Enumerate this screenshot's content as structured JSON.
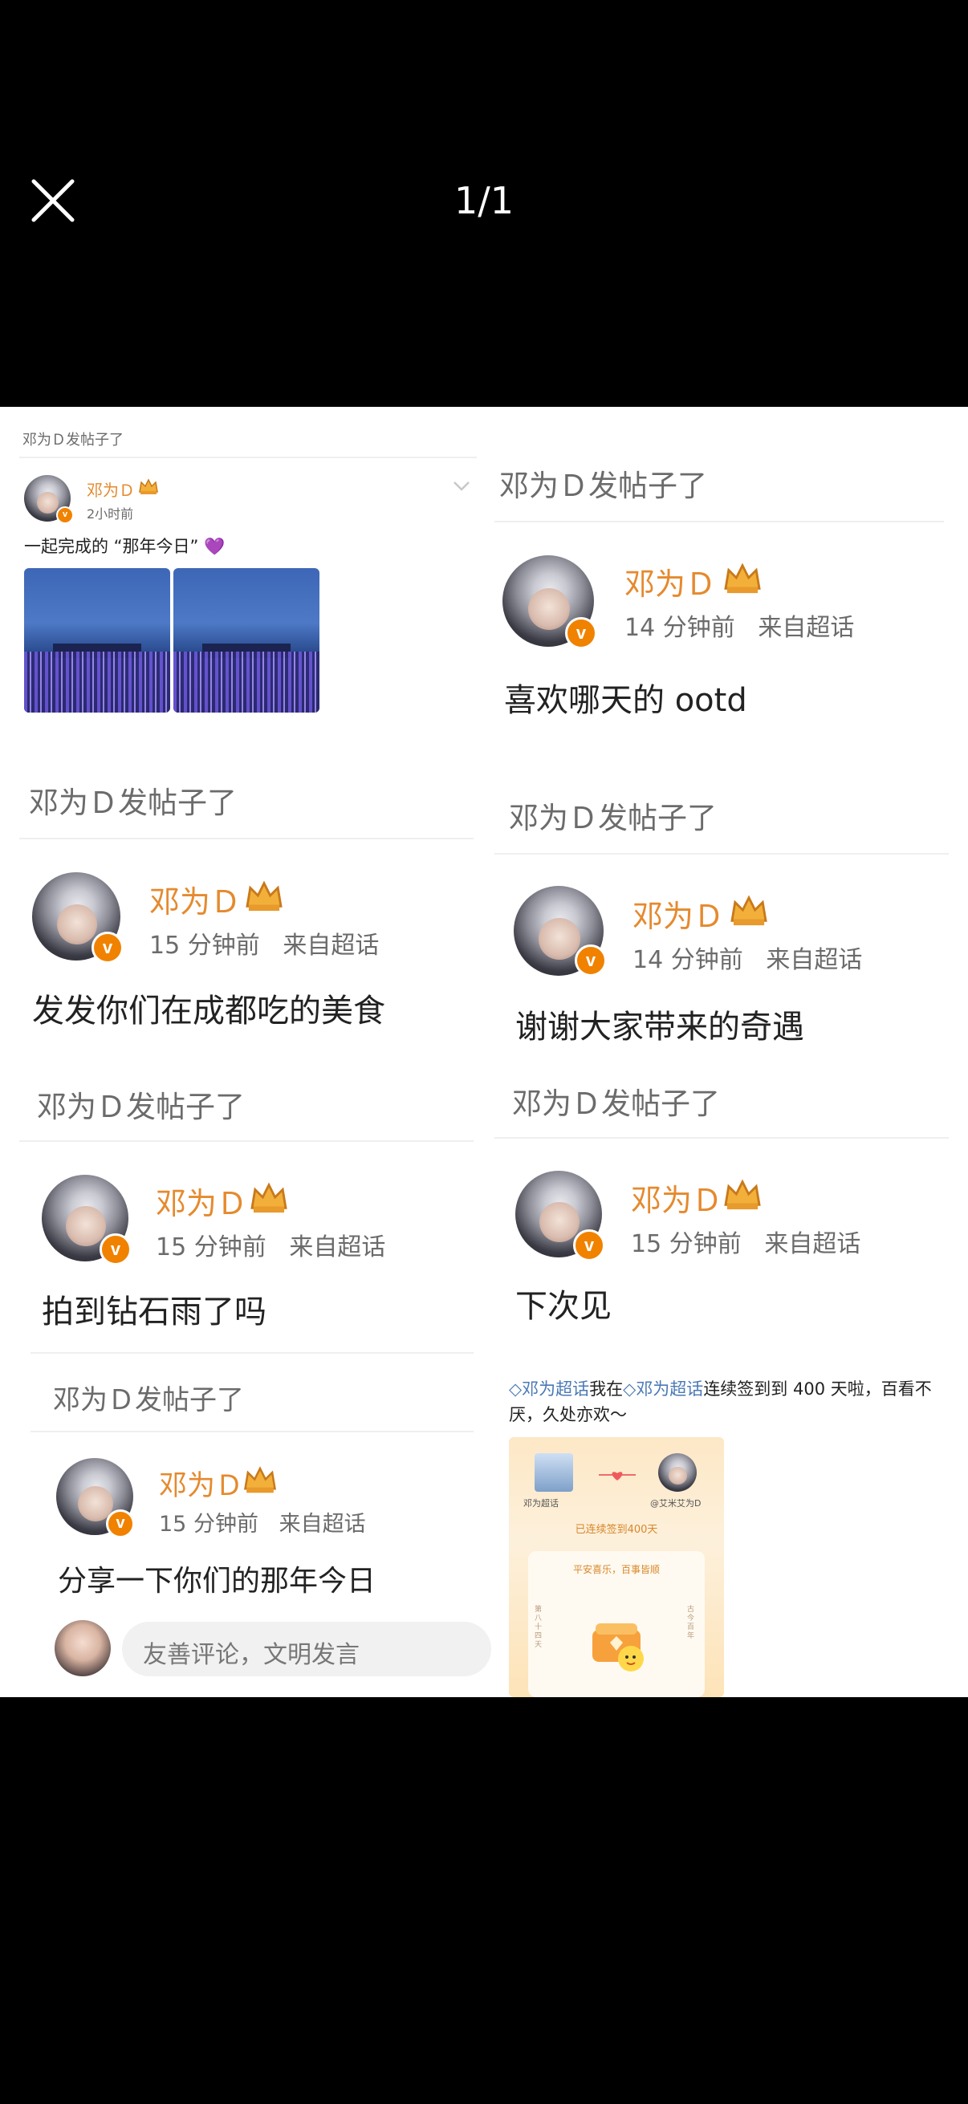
{
  "viewer": {
    "counter": "1/1"
  },
  "posts": {
    "p1": {
      "header": "邓为Ｄ发帖子了",
      "author": "邓为Ｄ",
      "time": "2小时前",
      "text": "一起完成的 “那年今日”",
      "heart": "💜"
    },
    "p2": {
      "header": "邓为Ｄ发帖子了",
      "author": "邓为Ｄ",
      "meta": "14 分钟前   来自超话",
      "text": "喜欢哪天的 ootd"
    },
    "p3": {
      "header": "邓为Ｄ发帖子了",
      "author": "邓为Ｄ",
      "meta": "15 分钟前   来自超话",
      "text": "发发你们在成都吃的美食"
    },
    "p4": {
      "header": "邓为Ｄ发帖子了",
      "author": "邓为Ｄ",
      "meta": "14 分钟前   来自超话",
      "text": "谢谢大家带来的奇遇"
    },
    "p5": {
      "header": "邓为Ｄ发帖子了",
      "author": "邓为Ｄ",
      "meta": "15 分钟前   来自超话",
      "text": "拍到钻石雨了吗"
    },
    "p6": {
      "header": "邓为Ｄ发帖子了",
      "author": "邓为Ｄ",
      "meta": "15 分钟前   来自超话",
      "text": "下次见"
    },
    "p7": {
      "header": "邓为Ｄ发帖子了",
      "author": "邓为Ｄ",
      "meta": "15 分钟前   来自超话",
      "text": "分享一下你们的那年今日",
      "comment_placeholder": "友善评论，文明发言"
    }
  },
  "checkin": {
    "topic_link": "邓为超话",
    "text_mid": "我在",
    "text_tail": "连续签到到 400 天啦，百看不",
    "line2": "厌，久处亦欢～",
    "card_left_name": "邓为超话",
    "card_right_name": "@艾米艾为D",
    "card_banner": "已连续签到400天",
    "card_wish": "平安喜乐，百事皆顺",
    "card_side_left": "第八十四天",
    "card_side_right": "古今百年"
  },
  "colors": {
    "accent": "#e58a2e",
    "badge": "#f08200",
    "link": "#4a79b5"
  },
  "icons": {
    "close": "close-icon",
    "crown": "crown-icon",
    "verified": "verified-badge-icon",
    "chevron": "chevron-down-icon"
  }
}
